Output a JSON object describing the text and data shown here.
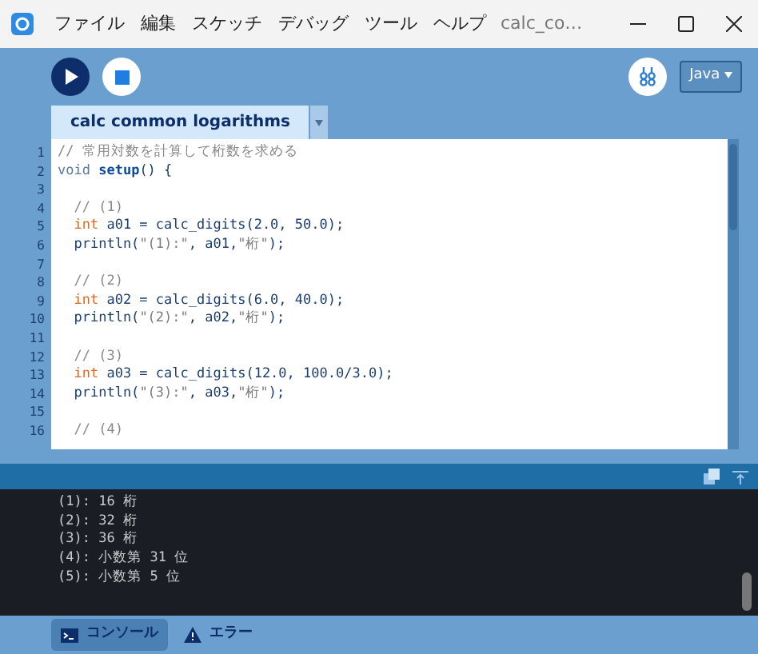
{
  "window": {
    "title": "calc_co…"
  },
  "menu": [
    {
      "label": "ファイル"
    },
    {
      "label": "編集"
    },
    {
      "label": "スケッチ"
    },
    {
      "label": "デバッグ"
    },
    {
      "label": "ツール"
    },
    {
      "label": "ヘルプ"
    }
  ],
  "toolbar": {
    "mode": "Java"
  },
  "tabs": [
    {
      "label": "calc common logarithms",
      "selected": true
    }
  ],
  "editor": {
    "lines": [
      {
        "number": "1",
        "tokens": [
          {
            "kind": "comment",
            "text": "// 常用対数を計算して桁数を求める"
          }
        ]
      },
      {
        "number": "2",
        "tokens": [
          {
            "kind": "type",
            "text": "void "
          },
          {
            "kind": "func",
            "text": "setup"
          },
          {
            "kind": "plain",
            "text": "() {"
          }
        ]
      },
      {
        "number": "3"
      },
      {
        "number": "4",
        "tokens": [
          {
            "kind": "comment",
            "text": "  // (1)"
          }
        ]
      },
      {
        "number": "5",
        "tokens": [
          {
            "kind": "keyword",
            "text": "  int"
          },
          {
            "kind": "plain",
            "text": " a01 = calc_digits(2.0, 50.0);"
          }
        ]
      },
      {
        "number": "6",
        "tokens": [
          {
            "kind": "plain",
            "text": "  println("
          },
          {
            "kind": "string",
            "text": "\"(1):\""
          },
          {
            "kind": "plain",
            "text": ", a01,"
          },
          {
            "kind": "string",
            "text": "\"桁\""
          },
          {
            "kind": "plain",
            "text": ");"
          }
        ]
      },
      {
        "number": "7"
      },
      {
        "number": "8",
        "tokens": [
          {
            "kind": "comment",
            "text": "  // (2)"
          }
        ]
      },
      {
        "number": "9",
        "tokens": [
          {
            "kind": "keyword",
            "text": "  int"
          },
          {
            "kind": "plain",
            "text": " a02 = calc_digits(6.0, 40.0);"
          }
        ]
      },
      {
        "number": "10",
        "tokens": [
          {
            "kind": "plain",
            "text": "  println("
          },
          {
            "kind": "string",
            "text": "\"(2):\""
          },
          {
            "kind": "plain",
            "text": ", a02,"
          },
          {
            "kind": "string",
            "text": "\"桁\""
          },
          {
            "kind": "plain",
            "text": ");"
          }
        ]
      },
      {
        "number": "11"
      },
      {
        "number": "12",
        "tokens": [
          {
            "kind": "comment",
            "text": "  // (3)"
          }
        ]
      },
      {
        "number": "13",
        "tokens": [
          {
            "kind": "keyword",
            "text": "  int"
          },
          {
            "kind": "plain",
            "text": " a03 = calc_digits(12.0, 100.0/3.0);"
          }
        ]
      },
      {
        "number": "14",
        "tokens": [
          {
            "kind": "plain",
            "text": "  println("
          },
          {
            "kind": "string",
            "text": "\"(3):\""
          },
          {
            "kind": "plain",
            "text": ", a03,"
          },
          {
            "kind": "string",
            "text": "\"桁\""
          },
          {
            "kind": "plain",
            "text": ");"
          }
        ]
      },
      {
        "number": "15"
      },
      {
        "number": "16",
        "tokens": [
          {
            "kind": "comment",
            "text": "  // (4)"
          }
        ]
      }
    ]
  },
  "console": {
    "lines": [
      "(1): 16 桁",
      "(2): 32 桁",
      "(3): 36 桁",
      "(4): 小数第 31 位",
      "(5): 小数第 5 位"
    ]
  },
  "bottom_tabs": [
    {
      "label": "コンソール",
      "kind": "console",
      "selected": true
    },
    {
      "label": "エラー",
      "kind": "error",
      "selected": false
    }
  ]
}
